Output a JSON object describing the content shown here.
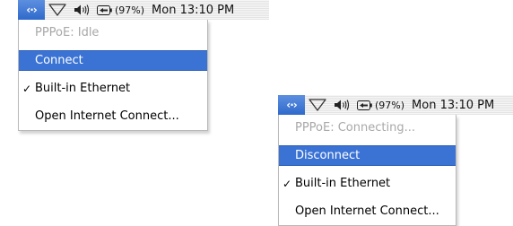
{
  "panels": [
    {
      "menubar": {
        "pppoe_icon": "pppoe-status-icon",
        "airport_icon": "airport-wifi-icon",
        "volume_icon": "volume-speaker-icon",
        "battery_icon": "battery-icon",
        "battery_percent": "(97%)",
        "clock": "Mon 13:10 PM"
      },
      "menu": {
        "status": "PPPoE: Idle",
        "action": "Connect",
        "interface": "Built-in Ethernet",
        "interface_check": "✓",
        "open_app": "Open Internet Connect..."
      }
    },
    {
      "menubar": {
        "pppoe_icon": "pppoe-status-icon",
        "airport_icon": "airport-wifi-icon",
        "volume_icon": "volume-speaker-icon",
        "battery_icon": "battery-icon",
        "battery_percent": "(97%)",
        "clock": "Mon 13:10 PM"
      },
      "menu": {
        "status": "PPPoE: Connecting...",
        "action": "Disconnect",
        "interface": "Built-in Ethernet",
        "interface_check": "✓",
        "open_app": "Open Internet Connect..."
      }
    }
  ],
  "colors": {
    "highlight": "#3b73d4",
    "menubar_icon_active": "#4a7fd8",
    "disabled_text": "#a8a8a8"
  }
}
